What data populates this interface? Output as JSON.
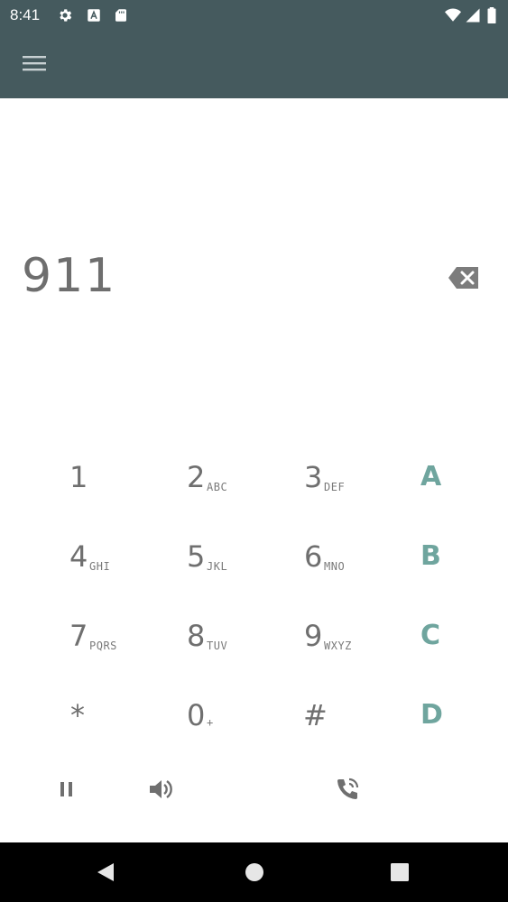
{
  "status_bar": {
    "time": "8:41",
    "left_icons": [
      "gear-icon",
      "font-a-icon",
      "sd-card-icon"
    ],
    "right_icons": [
      "wifi-icon",
      "signal-icon",
      "battery-icon"
    ]
  },
  "app_bar": {
    "menu_icon": "hamburger-menu-icon"
  },
  "dialer": {
    "number": "911",
    "backspace_icon": "backspace-icon"
  },
  "keypad": {
    "rows": [
      [
        {
          "digit": "1",
          "letters": ""
        },
        {
          "digit": "2",
          "letters": "ABC"
        },
        {
          "digit": "3",
          "letters": "DEF"
        },
        {
          "digit": "A",
          "letters": ""
        }
      ],
      [
        {
          "digit": "4",
          "letters": "GHI"
        },
        {
          "digit": "5",
          "letters": "JKL"
        },
        {
          "digit": "6",
          "letters": "MNO"
        },
        {
          "digit": "B",
          "letters": ""
        }
      ],
      [
        {
          "digit": "7",
          "letters": "PQRS"
        },
        {
          "digit": "8",
          "letters": "TUV"
        },
        {
          "digit": "9",
          "letters": "WXYZ"
        },
        {
          "digit": "C",
          "letters": ""
        }
      ],
      [
        {
          "digit": "*",
          "letters": ""
        },
        {
          "digit": "0",
          "letters": "+"
        },
        {
          "digit": "#",
          "letters": ""
        },
        {
          "digit": "D",
          "letters": ""
        }
      ]
    ]
  },
  "actions": {
    "icons": [
      "pause-icon",
      "speaker-volume-icon",
      "phone-call-icon"
    ]
  },
  "nav_bar": {
    "icons": [
      "back-triangle-icon",
      "home-circle-icon",
      "recents-square-icon"
    ]
  },
  "colors": {
    "app_bar": "#455a5e",
    "dtmf_letters": "#6fa59e",
    "digits": "#6f6f6f",
    "nav_bar": "#000000"
  }
}
